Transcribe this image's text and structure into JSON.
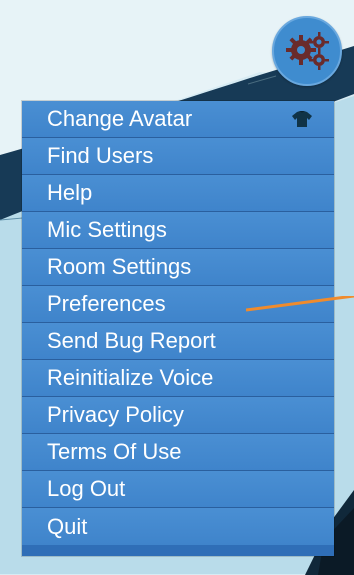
{
  "menu": {
    "items": [
      {
        "label": "Change Avatar",
        "icon": "tshirt-icon"
      },
      {
        "label": "Find Users"
      },
      {
        "label": "Help"
      },
      {
        "label": "Mic Settings"
      },
      {
        "label": "Room Settings"
      },
      {
        "label": "Preferences"
      },
      {
        "label": "Send Bug Report"
      },
      {
        "label": "Reinitialize Voice"
      },
      {
        "label": "Privacy Policy"
      },
      {
        "label": "Terms Of Use"
      },
      {
        "label": "Log Out"
      },
      {
        "label": "Quit"
      }
    ]
  },
  "settings_button": {
    "icon": "gears-icon"
  },
  "colors": {
    "menu_item": "#3f84cb",
    "menu_border": "#2a5f9e",
    "settings_button": "#3f8ccf",
    "gear_fill": "#6a2b2b",
    "accent_line": "#f08b2c"
  }
}
